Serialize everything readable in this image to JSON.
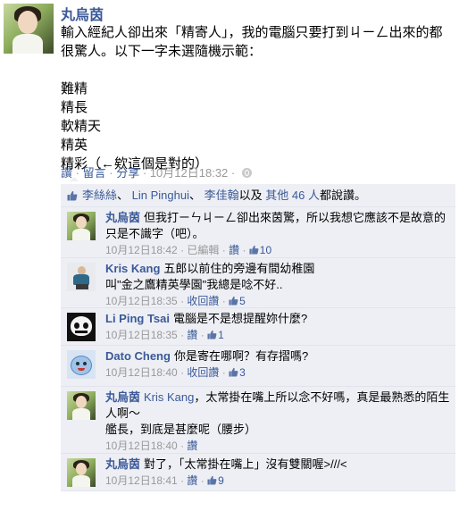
{
  "post": {
    "author": "丸烏茵",
    "message": "輸入經紀人卻出來「精寄人」，我的電腦只要打到ㄐㄧㄥ出來的都很驚人。以下一字未選隨機示範：\n\n難精\n精長\n軟精天\n精英\n精彩（←欸這個是對的）",
    "like_action": "讚",
    "comment_action": "留言",
    "share_action": "分享",
    "timestamp": "10月12日18:32",
    "separator": "·"
  },
  "likes": {
    "names": [
      "李絲絲",
      "Lin Pinghui",
      "李佳翰"
    ],
    "name_sep_1": "、",
    "name_sep_2": "、",
    "others_prefix": "以及",
    "others_link": "其他 46 人",
    "suffix": "都說讚。"
  },
  "comments": [
    {
      "author": "丸烏茵",
      "text": "但我打ㄧㄣㄐㄧㄥ卻出來茵驚，所以我想它應該不是故意的只是不識字（吧）。",
      "time": "10月12日18:42",
      "extra": "已編輯",
      "action": "讚",
      "likes": "10"
    },
    {
      "author": "Kris Kang",
      "text": "五郎以前住的旁邊有間幼稚園\n叫\"金之鷹精英學園\"我總是唸不好..",
      "time": "10月12日18:35",
      "action": "收回讚",
      "likes": "5"
    },
    {
      "author": "Li Ping Tsai",
      "text": "電腦是不是想提醒妳什麼?",
      "time": "10月12日18:35",
      "action": "讚",
      "likes": "1"
    },
    {
      "author": "Dato Cheng",
      "text": "你是寄在哪啊？有存摺嗎?",
      "time": "10月12日18:40",
      "action": "收回讚",
      "likes": "3"
    },
    {
      "author": "丸烏茵",
      "mention": "Kris Kang",
      "text": "，太常掛在嘴上所以念不好嗎，真是最熟悉的陌生人啊～\n艦長，到底是甚麼呢（腰步）",
      "time": "10月12日18:40",
      "action": "讚"
    },
    {
      "author": "丸烏茵",
      "text": "對了，「太常掛在嘴上」沒有雙關喔>///<",
      "time": "10月12日18:41",
      "action": "讚",
      "likes": "9"
    }
  ],
  "colors": {
    "link": "#3b5998",
    "ufi_background": "#edeff4",
    "meta_gray": "#999999"
  },
  "icons": {
    "audience": "globe-icon",
    "like": "thumbs-up-icon"
  }
}
